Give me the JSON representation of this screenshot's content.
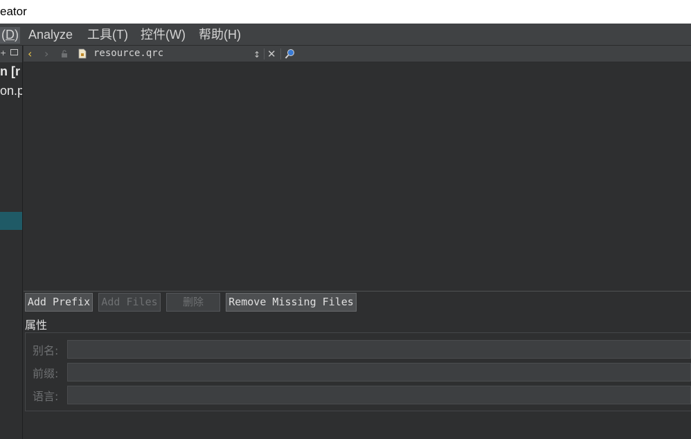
{
  "window": {
    "title": "eator"
  },
  "menubar": {
    "items": [
      {
        "label": "(D)",
        "mnemonic": "D"
      },
      {
        "label": "Analyze",
        "mnemonic": "A"
      },
      {
        "label": "工具(T)",
        "mnemonic": "T"
      },
      {
        "label": "控件(W)",
        "mnemonic": "W"
      },
      {
        "label": "帮助(H)",
        "mnemonic": "H"
      }
    ]
  },
  "sidebar": {
    "lines": [
      "n [r",
      "on.p"
    ],
    "toolbar_icons": [
      "plus-icon",
      "split-icon"
    ]
  },
  "editor_toolbar": {
    "filename": "resource.qrc",
    "icons": [
      "back-icon",
      "forward-icon",
      "lock-icon",
      "file-icon",
      "updown-icon",
      "close-icon",
      "locator-icon"
    ],
    "colors": {
      "back_arrow": "#e8c34a",
      "file_icon": "#f0e6c8"
    }
  },
  "buttons": {
    "add_prefix": "Add Prefix",
    "add_files": "Add Files",
    "delete": "删除",
    "remove_missing": "Remove Missing Files"
  },
  "properties": {
    "title": "属性",
    "alias_label": "别名:",
    "prefix_label": "前缀:",
    "language_label": "语言:",
    "alias_value": "",
    "prefix_value": "",
    "language_value": ""
  },
  "colors": {
    "menubar_bg": "#404244",
    "editor_bg": "#2e2f30",
    "selection": "#1f5a66"
  }
}
